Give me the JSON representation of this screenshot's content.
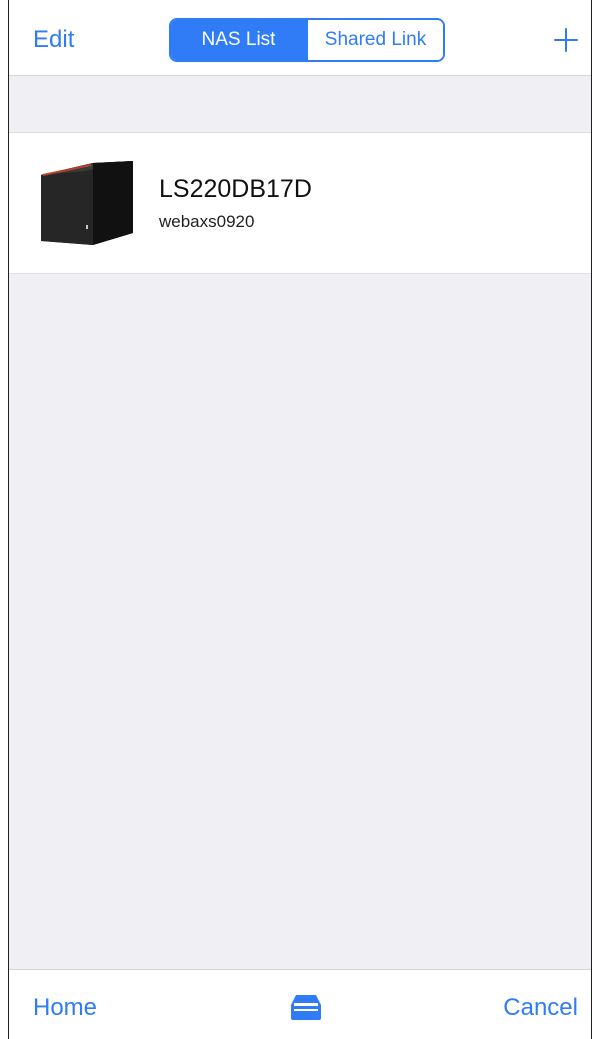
{
  "navbar": {
    "edit_label": "Edit",
    "segments": [
      {
        "label": "NAS List",
        "selected": true
      },
      {
        "label": "Shared Link",
        "selected": false
      }
    ],
    "add_icon": "plus-icon"
  },
  "nas_list": [
    {
      "name": "LS220DB17D",
      "user": "webaxs0920",
      "icon": "nas-device-icon"
    }
  ],
  "tabbar": {
    "home_label": "Home",
    "center_icon": "tray-icon",
    "cancel_label": "Cancel"
  },
  "colors": {
    "accent": "#2f7cf6",
    "background": "#efeff4",
    "surface": "#ffffff"
  }
}
